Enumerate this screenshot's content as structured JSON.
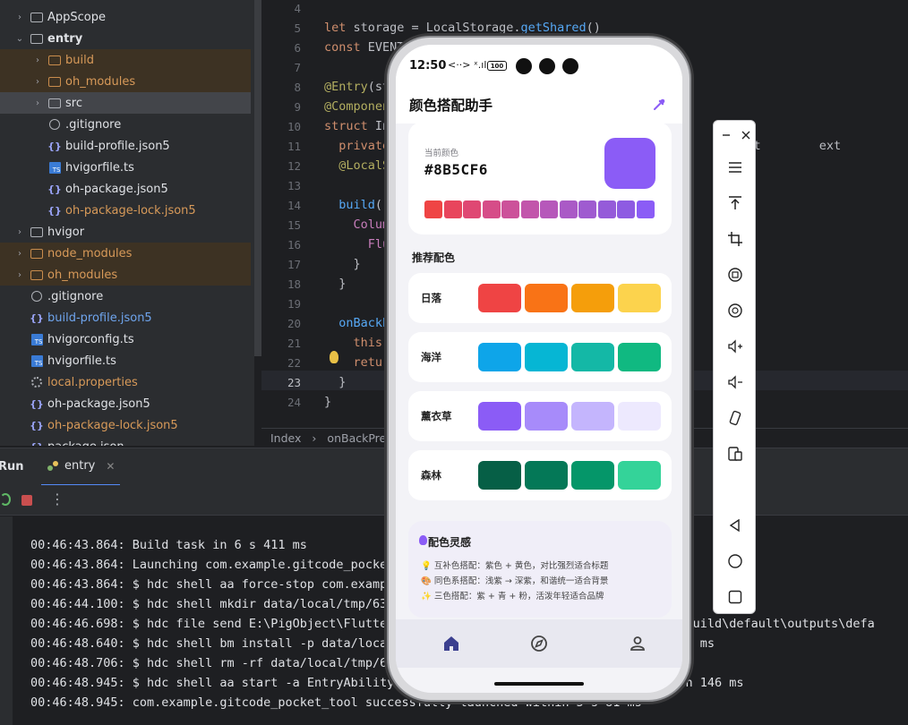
{
  "project_tree": {
    "items": [
      {
        "label": "AppScope",
        "type": "folder",
        "expandable": true,
        "indent": 1,
        "style": "normal"
      },
      {
        "label": "entry",
        "type": "module",
        "expandable": true,
        "expanded": true,
        "indent": 1,
        "style": "bold"
      },
      {
        "label": "build",
        "type": "folder-orange",
        "expandable": true,
        "indent": 2,
        "style": "orange"
      },
      {
        "label": "oh_modules",
        "type": "folder-orange",
        "expandable": true,
        "indent": 2,
        "style": "orange"
      },
      {
        "label": "src",
        "type": "folder",
        "expandable": true,
        "indent": 2,
        "style": "normal"
      },
      {
        "label": ".gitignore",
        "type": "ignore",
        "indent": 2,
        "style": "normal"
      },
      {
        "label": "build-profile.json5",
        "type": "json",
        "indent": 2,
        "style": "normal"
      },
      {
        "label": "hvigorfile.ts",
        "type": "ts",
        "indent": 2,
        "style": "normal"
      },
      {
        "label": "oh-package.json5",
        "type": "json",
        "indent": 2,
        "style": "normal"
      },
      {
        "label": "oh-package-lock.json5",
        "type": "json",
        "indent": 2,
        "style": "orange"
      },
      {
        "label": "hvigor",
        "type": "folder",
        "expandable": true,
        "indent": 1,
        "style": "normal"
      },
      {
        "label": "node_modules",
        "type": "folder-orange",
        "expandable": true,
        "indent": 1,
        "style": "orange"
      },
      {
        "label": "oh_modules",
        "type": "folder-orange",
        "expandable": true,
        "indent": 1,
        "style": "orange"
      },
      {
        "label": ".gitignore",
        "type": "ignore",
        "indent": 1,
        "style": "normal"
      },
      {
        "label": "build-profile.json5",
        "type": "json",
        "indent": 1,
        "style": "blue"
      },
      {
        "label": "hvigorconfig.ts",
        "type": "ts",
        "indent": 1,
        "style": "normal"
      },
      {
        "label": "hvigorfile.ts",
        "type": "ts",
        "indent": 1,
        "style": "normal"
      },
      {
        "label": "local.properties",
        "type": "gear",
        "indent": 1,
        "style": "orange"
      },
      {
        "label": "oh-package.json5",
        "type": "json",
        "indent": 1,
        "style": "normal"
      },
      {
        "label": "oh-package-lock.json5",
        "type": "json",
        "indent": 1,
        "style": "orange"
      },
      {
        "label": "package.json",
        "type": "json",
        "indent": 1,
        "style": "normal"
      }
    ]
  },
  "editor": {
    "line_numbers": [
      "4",
      "5",
      "6",
      "7",
      "8",
      "9",
      "10",
      "11",
      "12",
      "13",
      "14",
      "15",
      "16",
      "17",
      "18",
      "19",
      "20",
      "21",
      "22",
      "23",
      "24"
    ],
    "current_line": "23",
    "lines": [
      "",
      "let storage = LocalStorage.getShared()",
      "const EVENT",
      "",
      "@Entry(st",
      "@Component",
      "struct In",
      "  private                                               ilit        ext",
      "  @LocalSt",
      "",
      "  build()",
      "    Colum",
      "      Flu",
      "    }",
      "  }",
      "",
      "  onBackPr",
      "    this.",
      "    retur",
      "  }",
      "}"
    ],
    "breadcrumb": [
      "Index",
      "onBackPress("
    ]
  },
  "run_panel": {
    "title": "Run",
    "tab_label": "entry",
    "logs": [
      "00:46:43.864: Build task in 6 s 411 ms",
      "00:46:43.864: Launching com.example.gitcode_pocket",
      "00:46:43.864: $ hdc shell aa force-stop com.exampl",
      "00:46:44.100: $ hdc shell mkdir data/local/tmp/63e",
      "00:46:46.698: $ hdc file send E:\\PigObject\\Flutter                                   ntry\\build\\default\\outputs\\defa",
      "00:46:48.640: $ hdc shell bm install -p data/local                                    s 942 ms",
      "00:46:48.706: $ hdc shell rm -rf data/local/tmp/63",
      "00:46:48.945: $ hdc shell aa start -a EntryAbility                                   try in 146 ms",
      "00:46:48.945: com.example.gitcode_pocket_tool successfully launched within 5 s 81 ms"
    ]
  },
  "phone": {
    "status": {
      "time": "12:50",
      "signal": "<··> ˣ.ıl",
      "battery": "100"
    },
    "app_title": "颜色搭配助手",
    "current_color": {
      "label": "当前颜色",
      "hex": "#8B5CF6",
      "gradient": [
        "#ef4444",
        "#e8455c",
        "#df4873",
        "#d64d88",
        "#cc529a",
        "#c255ab",
        "#b658ba",
        "#aa5ac6",
        "#9f5bd0",
        "#955bd9",
        "#8e5be2",
        "#8b5cf6"
      ]
    },
    "section_title": "推荐配色",
    "palettes": [
      {
        "name": "日落",
        "colors": [
          "#ef4444",
          "#f97316",
          "#f59e0b",
          "#fcd34d"
        ]
      },
      {
        "name": "海洋",
        "colors": [
          "#0ea5e9",
          "#06b6d4",
          "#14b8a6",
          "#10b981"
        ]
      },
      {
        "name": "薰衣草",
        "colors": [
          "#8b5cf6",
          "#a78bfa",
          "#c4b5fd",
          "#ede9fe"
        ]
      },
      {
        "name": "森林",
        "colors": [
          "#065f46",
          "#047857",
          "#059669",
          "#34d399"
        ]
      }
    ],
    "inspiration": {
      "title": "配色灵感",
      "tips": [
        "💡 互补色搭配：紫色 + 黄色，对比强烈适合标题",
        "🎨 同色系搭配：浅紫 → 深紫，和谐统一适合背景",
        "✨ 三色搭配：紫 + 青 + 粉，活泼年轻适合品牌"
      ]
    },
    "tabbar": [
      {
        "icon": "home-icon",
        "active": true
      },
      {
        "icon": "compass-icon",
        "active": false
      },
      {
        "icon": "user-icon",
        "active": false
      }
    ],
    "accent": "#8b5cf6"
  },
  "side_toolbar": {
    "icons": [
      "minimize-icon",
      "close-icon",
      "menu-icon",
      "pin-top-icon",
      "crop-icon",
      "rotate-left-icon",
      "rotate-right-icon",
      "volume-up-icon",
      "volume-down-icon",
      "shake-icon",
      "multi-device-icon",
      "back-icon",
      "home-circle-icon",
      "recent-square-icon"
    ]
  }
}
